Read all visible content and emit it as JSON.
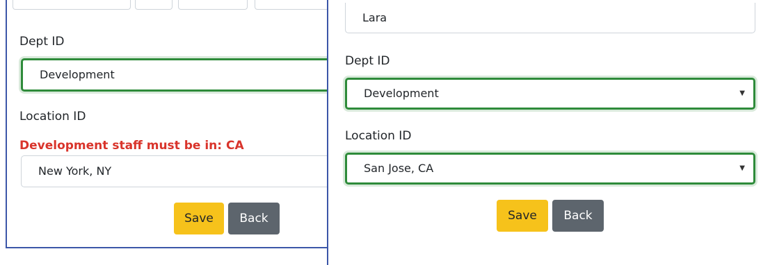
{
  "left_form": {
    "dept_label": "Dept ID",
    "dept_value": "Development",
    "location_label": "Location ID",
    "location_error": "Development staff must be in: CA",
    "location_value": "New York, NY",
    "save_label": "Save",
    "back_label": "Back"
  },
  "right_form": {
    "name_value": "Lara",
    "dept_label": "Dept ID",
    "dept_value": "Development",
    "location_label": "Location ID",
    "location_value": "San Jose, CA",
    "save_label": "Save",
    "back_label": "Back"
  },
  "icons": {
    "select_caret": "chevron-down-icon"
  },
  "colors": {
    "valid_border": "#2e8b3a",
    "error_text": "#d9342b",
    "save_button": "#f6c21b",
    "back_button": "#5d656d",
    "panel_border": "#3b56a8"
  }
}
